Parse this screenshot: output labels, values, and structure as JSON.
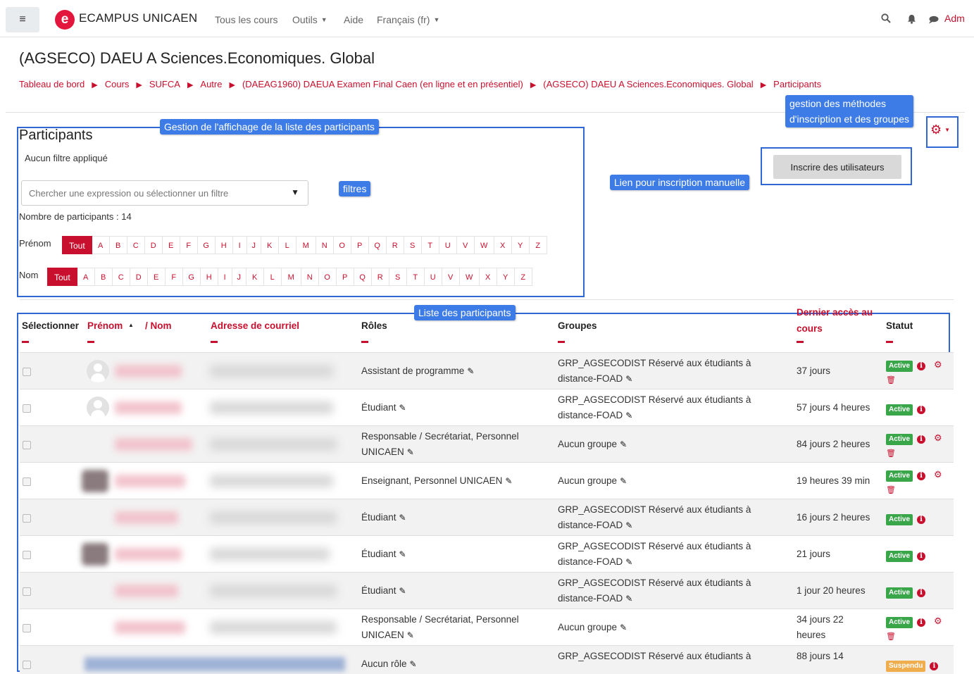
{
  "nav": {
    "menu_icon": "≡",
    "brand": "ECAMPUS UNICAEN",
    "brand_letter": "e",
    "links": [
      "Tous les cours",
      "Outils",
      "Aide",
      "Français (fr)"
    ],
    "user_truncated": "Adm",
    "icons": [
      "search-icon",
      "bell-icon",
      "chat-icon"
    ]
  },
  "page": {
    "title": "(AGSECO) DAEU A Sciences.Economiques. Global",
    "breadcrumb": [
      "Tableau de bord",
      "Cours",
      "SUFCA",
      "Autre",
      "(DAEAG1960) DAEUA Examen Final Caen (en ligne et en présentiel)",
      "(AGSECO) DAEU A Sciences.Economiques. Global",
      "Participants"
    ]
  },
  "annotations": {
    "display": "Gestion de l'affichage de la liste des participants",
    "methods_line1": "gestion des méthodes",
    "methods_line2": "d'inscription et des groupes",
    "filters": "filtres",
    "manual": "Lien pour inscription manuelle",
    "list": "Liste des participants"
  },
  "participants": {
    "title": "Participants",
    "no_filter": "Aucun filtre appliqué",
    "search_placeholder": "Chercher une expression ou sélectionner un filtre",
    "count": "Nombre de participants : 14",
    "firstname_label": "Prénom",
    "lastname_label": "Nom",
    "all_label": "Tout",
    "letters": [
      "A",
      "B",
      "C",
      "D",
      "E",
      "F",
      "G",
      "H",
      "I",
      "J",
      "K",
      "L",
      "M",
      "N",
      "O",
      "P",
      "Q",
      "R",
      "S",
      "T",
      "U",
      "V",
      "W",
      "X",
      "Y",
      "Z"
    ],
    "enrol_button": "Inscrire des utilisateurs"
  },
  "table": {
    "headers": {
      "select": "Sélectionner",
      "firstname": "Prénom",
      "sort_arrow": "▲",
      "lastname": "/ Nom",
      "email": "Adresse de courriel",
      "roles": "Rôles",
      "groups": "Groupes",
      "last_access_line1": "Dernier accès au",
      "last_access_line2": "cours",
      "status": "Statut"
    },
    "badge_colors": {
      "Active": "#3aa64a",
      "Suspendu": "#f0ad4e"
    },
    "rows": [
      {
        "role": "Assistant de programme",
        "group_l1": "GRP_AGSECODIST Réservé aux étudiants à",
        "group_l2": "distance-FOAD",
        "access_l1": "37 jours",
        "access_l2": "",
        "status": "Active"
      },
      {
        "role": "Étudiant",
        "group_l1": "GRP_AGSECODIST Réservé aux étudiants à",
        "group_l2": "distance-FOAD",
        "access_l1": "57 jours 4 heures",
        "access_l2": "",
        "status": "Active"
      },
      {
        "role": "Responsable / Secrétariat, Personnel",
        "role_l2": "UNICAEN",
        "group_l1": "Aucun groupe",
        "group_l2": "",
        "access_l1": "84 jours 2 heures",
        "access_l2": "",
        "status": "Active"
      },
      {
        "role": "Enseignant, Personnel UNICAEN",
        "group_l1": "Aucun groupe",
        "group_l2": "",
        "access_l1": "19 heures 39 min",
        "access_l2": "",
        "status": "Active"
      },
      {
        "role": "Étudiant",
        "group_l1": "GRP_AGSECODIST Réservé aux étudiants à",
        "group_l2": "distance-FOAD",
        "access_l1": "16 jours 2 heures",
        "access_l2": "",
        "status": "Active"
      },
      {
        "role": "Étudiant",
        "group_l1": "GRP_AGSECODIST Réservé aux étudiants à",
        "group_l2": "distance-FOAD",
        "access_l1": "21 jours",
        "access_l2": "",
        "status": "Active"
      },
      {
        "role": "Étudiant",
        "group_l1": "GRP_AGSECODIST Réservé aux étudiants à",
        "group_l2": "distance-FOAD",
        "access_l1": "1 jour 20 heures",
        "access_l2": "",
        "status": "Active"
      },
      {
        "role": "Responsable / Secrétariat, Personnel",
        "role_l2": "UNICAEN",
        "group_l1": "Aucun groupe",
        "group_l2": "",
        "access_l1": "34 jours 22",
        "access_l2": "heures",
        "status": "Active"
      },
      {
        "role": "Aucun rôle",
        "group_l1": "GRP_AGSECODIST Réservé aux étudiants à",
        "group_l2": "",
        "access_l1": "88 jours 14",
        "access_l2": "",
        "status": "Suspendu"
      }
    ]
  }
}
